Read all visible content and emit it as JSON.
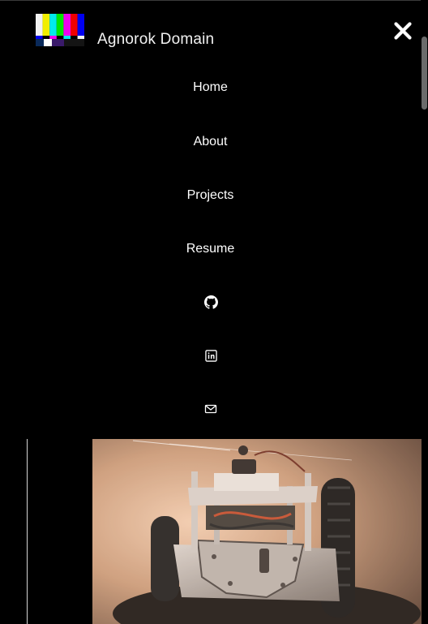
{
  "site": {
    "title": "Agnorok Domain",
    "logo_icon": "color-bars-logo"
  },
  "header": {
    "close_icon": "close-icon"
  },
  "nav": {
    "items": [
      {
        "label": "Home"
      },
      {
        "label": "About"
      },
      {
        "label": "Projects"
      },
      {
        "label": "Resume"
      }
    ],
    "icons": [
      {
        "name": "github-icon"
      },
      {
        "name": "linkedin-icon"
      },
      {
        "name": "mail-icon"
      }
    ]
  },
  "colors": {
    "background": "#000000",
    "text": "#ffffff",
    "divider": "#d6d6d6",
    "scrollbar_thumb": "#6b6b6b"
  }
}
